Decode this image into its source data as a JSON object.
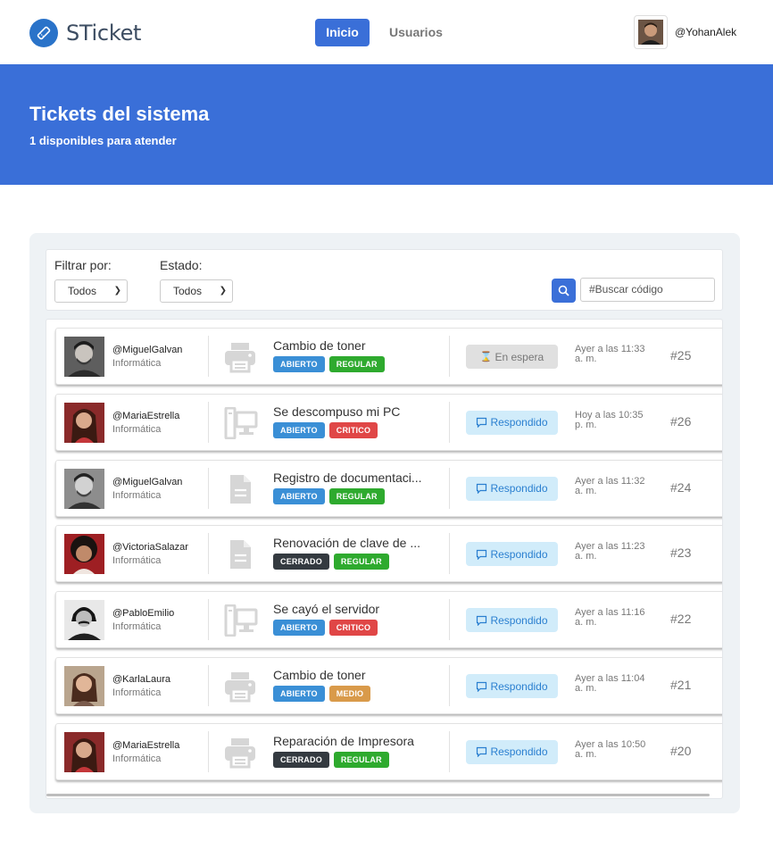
{
  "header": {
    "app_name": "STicket",
    "nav": {
      "inicio": "Inicio",
      "usuarios": "Usuarios"
    },
    "user": "@YohanAlek"
  },
  "hero": {
    "title": "Tickets del sistema",
    "subtitle": "1 disponibles para atender"
  },
  "filters": {
    "filter_label": "Filtrar por:",
    "filter_value": "Todos",
    "state_label": "Estado:",
    "state_value": "Todos",
    "search_placeholder": "#Buscar código"
  },
  "colors": {
    "primary": "#3a6fd8",
    "tag_abierto": "#3a8fd6",
    "tag_cerrado": "#343a40",
    "tag_regular": "#2eaa2e",
    "tag_critico": "#e04646",
    "tag_medio": "#d99a4a"
  },
  "tickets": [
    {
      "user": "@MiguelGalvan",
      "dept": "Informática",
      "device": "printer-icon",
      "subject": "Cambio de toner",
      "state": "ABIERTO",
      "priority": "REGULAR",
      "status": "En espera",
      "status_type": "wait",
      "time1": "Ayer a las 11:33",
      "time2": "a. m.",
      "code": "#25",
      "avatar": "man-dark"
    },
    {
      "user": "@MariaEstrella",
      "dept": "Informática",
      "device": "computer-icon",
      "subject": "Se descompuso mi PC",
      "state": "ABIERTO",
      "priority": "CRITICO",
      "status": "Respondido",
      "status_type": "resp",
      "time1": "Hoy a las 10:35",
      "time2": "p. m.",
      "code": "#26",
      "avatar": "woman-red"
    },
    {
      "user": "@MiguelGalvan",
      "dept": "Informática",
      "device": "document-icon",
      "subject": "Registro de documentaci...",
      "state": "ABIERTO",
      "priority": "REGULAR",
      "status": "Respondido",
      "status_type": "resp",
      "time1": "Ayer a las 11:32",
      "time2": "a. m.",
      "code": "#24",
      "avatar": "man-bw"
    },
    {
      "user": "@VictoriaSalazar",
      "dept": "Informática",
      "device": "document-icon",
      "subject": "Renovación de clave de ...",
      "state": "CERRADO",
      "priority": "REGULAR",
      "status": "Respondido",
      "status_type": "resp",
      "time1": "Ayer a las 11:23",
      "time2": "a. m.",
      "code": "#23",
      "avatar": "woman-curly"
    },
    {
      "user": "@PabloEmilio",
      "dept": "Informática",
      "device": "computer-icon",
      "subject": "Se cayó el servidor",
      "state": "ABIERTO",
      "priority": "CRITICO",
      "status": "Respondido",
      "status_type": "resp",
      "time1": "Ayer a las 11:16",
      "time2": "a. m.",
      "code": "#22",
      "avatar": "man-mustache"
    },
    {
      "user": "@KarlaLaura",
      "dept": "Informática",
      "device": "printer-icon",
      "subject": "Cambio de toner",
      "state": "ABIERTO",
      "priority": "MEDIO",
      "status": "Respondido",
      "status_type": "resp",
      "time1": "Ayer a las 11:04",
      "time2": "a. m.",
      "code": "#21",
      "avatar": "woman-light"
    },
    {
      "user": "@MariaEstrella",
      "dept": "Informática",
      "device": "printer-icon",
      "subject": "Reparación de Impresora",
      "state": "CERRADO",
      "priority": "REGULAR",
      "status": "Respondido",
      "status_type": "resp",
      "time1": "Ayer a las 10:50",
      "time2": "a. m.",
      "code": "#20",
      "avatar": "woman-red"
    }
  ]
}
